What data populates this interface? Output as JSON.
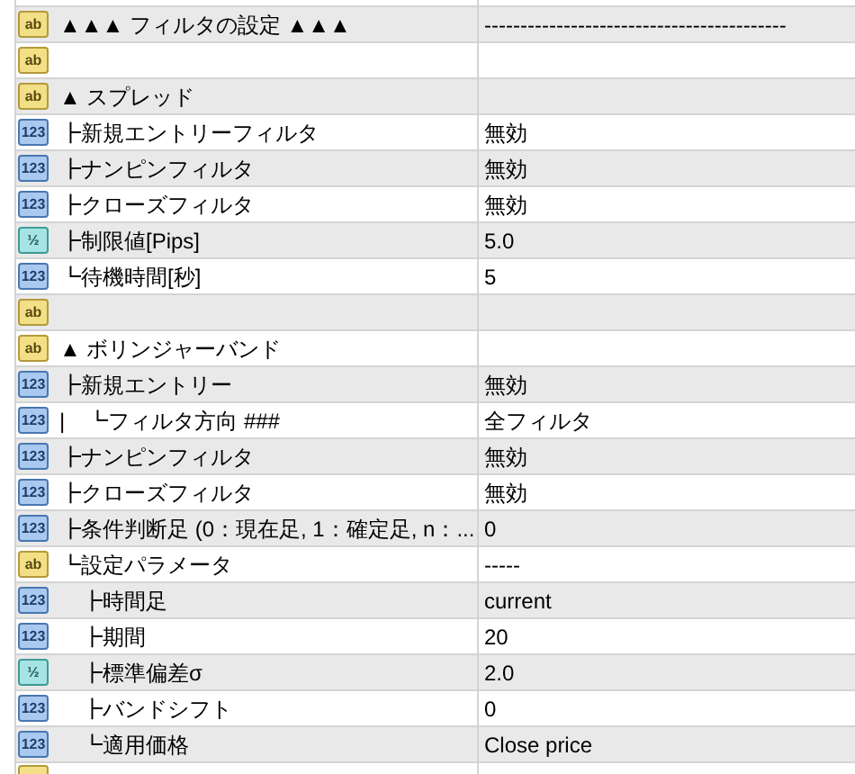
{
  "rows": [
    {
      "kind": "string",
      "icon": "ab",
      "name": "▲▲▲ フィルタの設定 ▲▲▲",
      "value": "------------------------------------------"
    },
    {
      "kind": "string",
      "icon": "ab"
    },
    {
      "kind": "string",
      "icon": "ab",
      "name": "▲ スプレッド"
    },
    {
      "kind": "int",
      "icon": "123",
      "name": "┣新規エントリーフィルタ",
      "value": "無効"
    },
    {
      "kind": "int",
      "icon": "123",
      "name": "┣ナンピンフィルタ",
      "value": "無効"
    },
    {
      "kind": "int",
      "icon": "123",
      "name": "┣クローズフィルタ",
      "value": "無効"
    },
    {
      "kind": "double",
      "icon": "½",
      "name": "┣制限値[Pips]",
      "value": "5.0"
    },
    {
      "kind": "int",
      "icon": "123",
      "name": "┗待機時間[秒]",
      "value": "5"
    },
    {
      "kind": "string",
      "icon": "ab"
    },
    {
      "kind": "string",
      "icon": "ab",
      "name": "▲ ボリンジャーバンド"
    },
    {
      "kind": "int",
      "icon": "123",
      "name": "┣新規エントリー",
      "value": "無効"
    },
    {
      "kind": "int",
      "icon": "123",
      "name": "|　┗フィルタ方向 ###",
      "value": "全フィルタ"
    },
    {
      "kind": "int",
      "icon": "123",
      "name": "┣ナンピンフィルタ",
      "value": "無効"
    },
    {
      "kind": "int",
      "icon": "123",
      "name": "┣クローズフィルタ",
      "value": "無効"
    },
    {
      "kind": "int",
      "icon": "123",
      "name": "┣条件判断足 (0：現在足, 1：確定足, n：...",
      "value": "0"
    },
    {
      "kind": "string",
      "icon": "ab",
      "name": "┗設定パラメータ",
      "value": "-----"
    },
    {
      "kind": "int",
      "icon": "123",
      "name": "　┣時間足",
      "value": "current"
    },
    {
      "kind": "int",
      "icon": "123",
      "name": "　┣期間",
      "value": "20"
    },
    {
      "kind": "double",
      "icon": "½",
      "name": "　┣標準偏差σ",
      "value": "2.0"
    },
    {
      "kind": "int",
      "icon": "123",
      "name": "　┣バンドシフト",
      "value": "0"
    },
    {
      "kind": "int",
      "icon": "123",
      "name": "　┗適用価格",
      "value": "Close price"
    },
    {
      "kind": "string"
    }
  ]
}
